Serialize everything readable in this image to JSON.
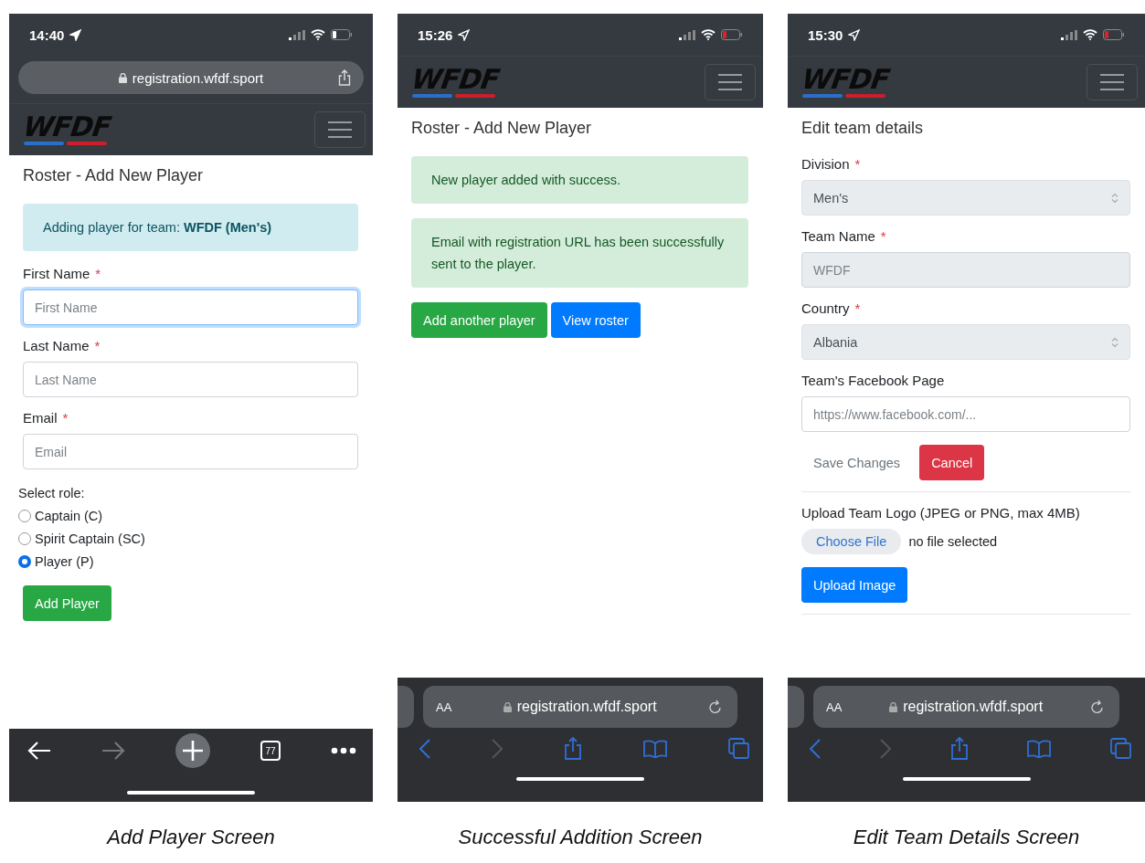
{
  "screens": [
    {
      "caption": "Add Player Screen",
      "status": {
        "time": "14:40",
        "battery_low": false
      },
      "top_url": {
        "url": "registration.wfdf.sport"
      },
      "logo": "WFDF",
      "content": [
        {
          "kind": "heading",
          "text": "Roster - Add New Player"
        },
        {
          "kind": "alert_info",
          "text": "Adding player for team: **WFDF (Men's)**"
        },
        {
          "kind": "label",
          "text": "First Name",
          "required_mark": "*"
        },
        {
          "kind": "input",
          "placeholder": "First Name",
          "focused": true,
          "disabled": false
        },
        {
          "kind": "label",
          "text": "Last Name",
          "required_mark": "*"
        },
        {
          "kind": "input",
          "placeholder": "Last Name",
          "focused": false,
          "disabled": false
        },
        {
          "kind": "label",
          "text": "Email",
          "required_mark": "*"
        },
        {
          "kind": "input",
          "placeholder": "Email",
          "focused": false,
          "disabled": false
        },
        {
          "kind": "radio_group",
          "label": "Select role:",
          "options": [
            {
              "label": "Captain (C)",
              "selected": false
            },
            {
              "label": "Spirit Captain (SC)",
              "selected": false
            },
            {
              "label": "Player (P)",
              "selected": true
            }
          ]
        },
        {
          "kind": "buttons",
          "items": [
            {
              "label": "Add Player",
              "kind": "success"
            }
          ]
        }
      ],
      "bottom_bar": {
        "kind": "chrome",
        "tab_count": "77",
        "back_disabled": false,
        "forward_disabled": true
      }
    },
    {
      "caption": "Successful Addition Screen",
      "status": {
        "time": "15:26",
        "battery_low": true
      },
      "logo": "WFDF",
      "content": [
        {
          "kind": "heading",
          "text": "Roster - Add New Player"
        },
        {
          "kind": "alert_success",
          "text": "New player added with success."
        },
        {
          "kind": "alert_success",
          "text": "Email with registration URL has been successfully sent to the player."
        },
        {
          "kind": "buttons",
          "items": [
            {
              "label": "Add another player",
              "kind": "success"
            },
            {
              "label": "View roster",
              "kind": "primary"
            }
          ]
        }
      ],
      "bottom_bar": {
        "kind": "safari",
        "text_size": "AA",
        "url": "registration.wfdf.sport",
        "back_disabled": false,
        "forward_disabled": true
      }
    },
    {
      "caption": "Edit Team Details Screen",
      "status": {
        "time": "15:30",
        "battery_low": true
      },
      "logo": "WFDF",
      "content": [
        {
          "kind": "heading",
          "text": "Edit team details"
        },
        {
          "kind": "label",
          "text": "Division",
          "required_mark": "*"
        },
        {
          "kind": "select",
          "value": "Men's"
        },
        {
          "kind": "label",
          "text": "Team Name",
          "required_mark": "*"
        },
        {
          "kind": "input",
          "placeholder": "WFDF",
          "focused": false,
          "disabled": true
        },
        {
          "kind": "label",
          "text": "Country",
          "required_mark": "*"
        },
        {
          "kind": "select",
          "value": "Albania"
        },
        {
          "kind": "label",
          "text": "Team's Facebook Page"
        },
        {
          "kind": "input",
          "placeholder": "https://www.facebook.com/...",
          "focused": false,
          "disabled": false
        },
        {
          "kind": "buttons",
          "items": [
            {
              "label": "Save Changes",
              "kind": "link"
            },
            {
              "label": "Cancel",
              "kind": "danger"
            }
          ]
        },
        {
          "kind": "divider"
        },
        {
          "kind": "label",
          "text": "Upload Team Logo (JPEG or PNG, max 4MB)"
        },
        {
          "kind": "file",
          "button": "Choose File",
          "status": "no file selected"
        },
        {
          "kind": "buttons",
          "items": [
            {
              "label": "Upload Image",
              "kind": "primary"
            }
          ]
        },
        {
          "kind": "divider"
        }
      ],
      "bottom_bar": {
        "kind": "safari",
        "text_size": "AA",
        "url": "registration.wfdf.sport",
        "back_disabled": false,
        "forward_disabled": true
      }
    }
  ]
}
